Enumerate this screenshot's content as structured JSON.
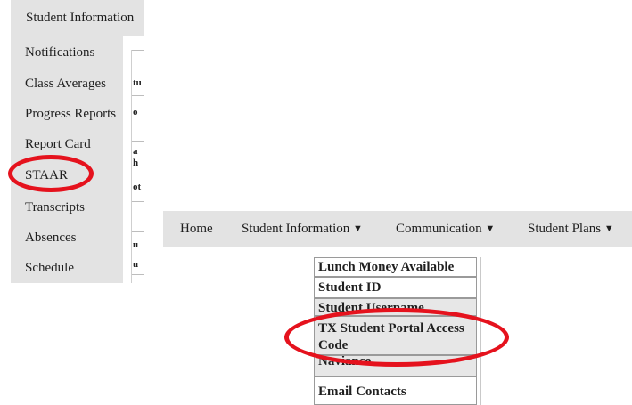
{
  "left_panel": {
    "header_label": "Student Information",
    "header_caret": "▼",
    "menu_items": [
      {
        "label": "Notifications"
      },
      {
        "label": "Class Averages"
      },
      {
        "label": "Progress Reports"
      },
      {
        "label": "Report Card"
      },
      {
        "label": "STAAR"
      },
      {
        "label": "Transcripts"
      },
      {
        "label": "Absences"
      },
      {
        "label": "Schedule"
      }
    ],
    "behind_fragments": [
      "tu",
      "o",
      "a",
      "h",
      "ot",
      "u",
      "u"
    ]
  },
  "navbar": {
    "items": [
      {
        "label": "Home",
        "caret": ""
      },
      {
        "label": "Student Information",
        "caret": "▼"
      },
      {
        "label": "Communication",
        "caret": "▼"
      },
      {
        "label": "Student Plans",
        "caret": "▼"
      }
    ]
  },
  "info_table": {
    "rows": [
      {
        "label": "Lunch Money Available"
      },
      {
        "label": "Student ID"
      },
      {
        "label": "Student Username"
      },
      {
        "label": "TX Student Portal Access Code"
      },
      {
        "label": "Naviance"
      },
      {
        "label": "Email Contacts"
      }
    ]
  },
  "colors": {
    "menu_bg": "#e3e3e3",
    "annotation_red": "#e5121d",
    "text": "#1f1f1f"
  }
}
